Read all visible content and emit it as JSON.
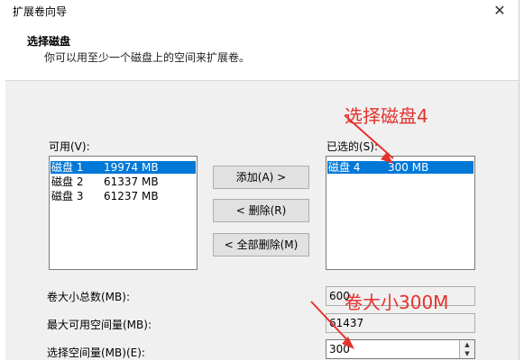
{
  "window": {
    "title": "扩展卷向导",
    "close_glyph": "✕"
  },
  "header": {
    "heading": "选择磁盘",
    "description": "你可以用至少一个磁盘上的空间来扩展卷。"
  },
  "available": {
    "label": "可用(V):",
    "rows": [
      {
        "disk": "磁盘 1",
        "size": "19974 MB",
        "selected": true
      },
      {
        "disk": "磁盘 2",
        "size": "61337 MB",
        "selected": false
      },
      {
        "disk": "磁盘 3",
        "size": "61237 MB",
        "selected": false
      }
    ]
  },
  "selected": {
    "label": "已选的(S):",
    "rows": [
      {
        "disk": "磁盘 4",
        "size": "300 MB",
        "selected": true
      }
    ]
  },
  "buttons": {
    "add": "添加(A) >",
    "remove": "< 删除(R)",
    "remove_all": "< 全部删除(M)"
  },
  "fields": {
    "total_label": "卷大小总数(MB):",
    "total_value": "600",
    "max_label": "最大可用空间量(MB):",
    "max_value": "61437",
    "select_label": "选择空间量(MB)(E):",
    "select_value": "300"
  },
  "annotations": {
    "select_disk": "选择磁盘4",
    "volume_size": "卷大小300M",
    "color": "#e5322d"
  },
  "colors": {
    "selection": "#0078d7"
  }
}
